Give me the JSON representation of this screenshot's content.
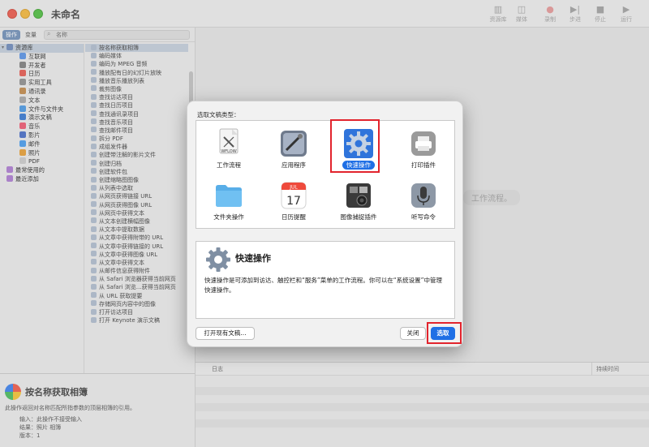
{
  "window": {
    "title": "未命名",
    "toolbar": [
      {
        "name": "library",
        "label": "资源库",
        "glyph": "▥"
      },
      {
        "name": "media",
        "label": "媒体",
        "glyph": "◫"
      },
      {
        "name": "record",
        "label": "录制",
        "glyph": "●"
      },
      {
        "name": "step",
        "label": "步进",
        "glyph": "▶|"
      },
      {
        "name": "stop",
        "label": "停止",
        "glyph": "■"
      },
      {
        "name": "run",
        "label": "运行",
        "glyph": "▶"
      }
    ]
  },
  "library": {
    "tab_actions": "操作",
    "tab_variables": "变量",
    "search_placeholder": "名称",
    "items": [
      {
        "label": "资源库",
        "color": "#7d96c2",
        "indent": 0,
        "expander": "▾",
        "selected": true
      },
      {
        "label": "互联网",
        "color": "#6a9ee8",
        "indent": 1
      },
      {
        "label": "开发者",
        "color": "#8c8c8c",
        "indent": 1
      },
      {
        "label": "日历",
        "color": "#e86b62",
        "indent": 1
      },
      {
        "label": "实用工具",
        "color": "#9a9a9a",
        "indent": 1
      },
      {
        "label": "通讯录",
        "color": "#c7955d",
        "indent": 1
      },
      {
        "label": "文本",
        "color": "#b0b0b0",
        "indent": 1
      },
      {
        "label": "文件与文件夹",
        "color": "#5ea3e6",
        "indent": 1
      },
      {
        "label": "演示文稿",
        "color": "#4c86d6",
        "indent": 1
      },
      {
        "label": "音乐",
        "color": "#f06a80",
        "indent": 1
      },
      {
        "label": "影片",
        "color": "#5b7ccc",
        "indent": 1
      },
      {
        "label": "邮件",
        "color": "#5ba6f0",
        "indent": 1
      },
      {
        "label": "照片",
        "color": "#e9a84a",
        "indent": 1
      },
      {
        "label": "PDF",
        "color": "#d0d0d0",
        "indent": 1
      },
      {
        "label": "最常使用的",
        "color": "#b58ad6",
        "indent": 0
      },
      {
        "label": "最近添加",
        "color": "#b58ad6",
        "indent": 0
      }
    ],
    "actions": [
      "按名称获取相簿",
      "编码媒体",
      "编码为 MPEG 音频",
      "播放配有日的幻灯片放映",
      "播放音乐播放列表",
      "裁剪图像",
      "查找访达项目",
      "查找日历项目",
      "查找通讯录项目",
      "查找音乐项目",
      "查找邮件项目",
      "拆分 PDF",
      "成组发件器",
      "创建带注解的影片文件",
      "创建归档",
      "创建软件包",
      "创建缩略图图像",
      "从列表中选取",
      "从网页获得链接 URL",
      "从网页获得图像 URL",
      "从网页中获得文本",
      "从文本创建横幅图像",
      "从文本中提取数据",
      "从文章中获得附带的 URL",
      "从文章中获得链接的 URL",
      "从文章中获得图像 URL",
      "从文章中获得文本",
      "从邮件信息获得附件",
      "从 Safari 浏览器获得当前网页",
      "从 Safari 浏览…获得当前网页",
      "从 URL 获取提要",
      "存储网页内容中的图像",
      "打开访达项目",
      "打开 Keynote 演示文稿"
    ],
    "selected_action": "按名称获取相簿",
    "description": {
      "title": "按名称获取相簿",
      "text": "此操作返回对名称匹配所指参数的顶层相簿的引用。",
      "input": "输入：此操作不接受输入",
      "result": "结果：照片 相簿",
      "version": "版本：1"
    }
  },
  "workflow": {
    "hint": "工作流程。",
    "log_column": "日志",
    "duration_column": "持续时间"
  },
  "sheet": {
    "title": "选取文稿类型：",
    "types": [
      {
        "name": "workflow",
        "label": "工作流程",
        "selected": false
      },
      {
        "name": "application",
        "label": "应用程序",
        "selected": false
      },
      {
        "name": "quick-action",
        "label": "快速操作",
        "selected": true
      },
      {
        "name": "print-plugin",
        "label": "打印插件",
        "selected": false
      },
      {
        "name": "folder-action",
        "label": "文件夹操作",
        "selected": false
      },
      {
        "name": "calendar-alarm",
        "label": "日历提醒",
        "selected": false
      },
      {
        "name": "image-capture-plugin",
        "label": "图像捕捉插件",
        "selected": false
      },
      {
        "name": "dictation-command",
        "label": "听写命令",
        "selected": false
      }
    ],
    "workflow_icon_text": "WFLOW",
    "calendar_month": "JUL",
    "calendar_day": "17",
    "detail_title": "快速操作",
    "detail_description": "快速操作是可添加到访达、触控栏和“服务”菜单的工作流程。你可以在“系统设置”中管理快速操作。",
    "open_existing_label": "打开现有文稿...",
    "close_label": "关闭",
    "choose_label": "选取"
  },
  "colors": {
    "accent": "#1f6fe5",
    "highlight": "#e2242d"
  }
}
